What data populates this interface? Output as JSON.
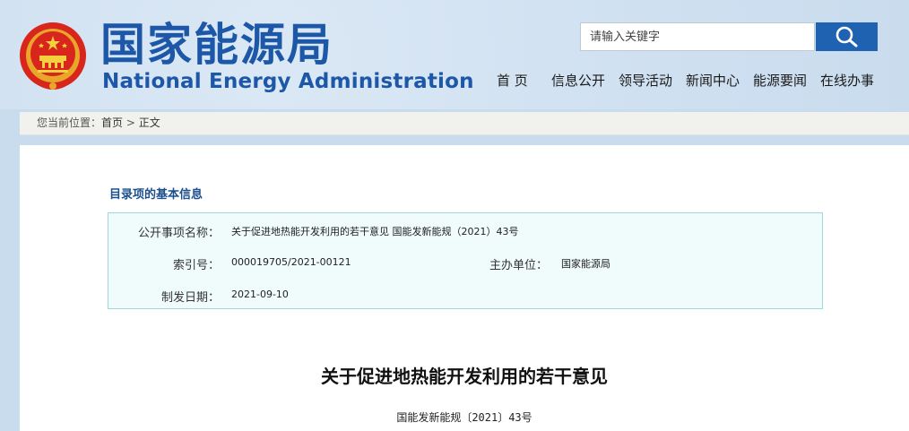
{
  "header": {
    "title_cn": "国家能源局",
    "title_en": "National Energy Administration",
    "search_placeholder": "请输入关键字",
    "brand_color": "#1d57a8"
  },
  "nav": {
    "items": [
      "首 页",
      "信息公开",
      "领导活动",
      "新闻中心",
      "能源要闻",
      "在线办事"
    ]
  },
  "breadcrumb": {
    "prefix": "您当前位置：",
    "home": "首页",
    "separator": ">",
    "current": "正文"
  },
  "catalog": {
    "title": "目录项的基本信息",
    "name_label": "公开事项名称：",
    "name_value": "关于促进地热能开发利用的若干意见 国能发新能规（2021）43号",
    "index_label": "索引号：",
    "index_value": "000019705/2021-00121",
    "org_label": "主办单位：",
    "org_value": "国家能源局",
    "date_label": "制发日期：",
    "date_value": "2021-09-10"
  },
  "article": {
    "title": "关于促进地热能开发利用的若干意见",
    "doc_number": "国能发新能规〔2021〕43号"
  }
}
